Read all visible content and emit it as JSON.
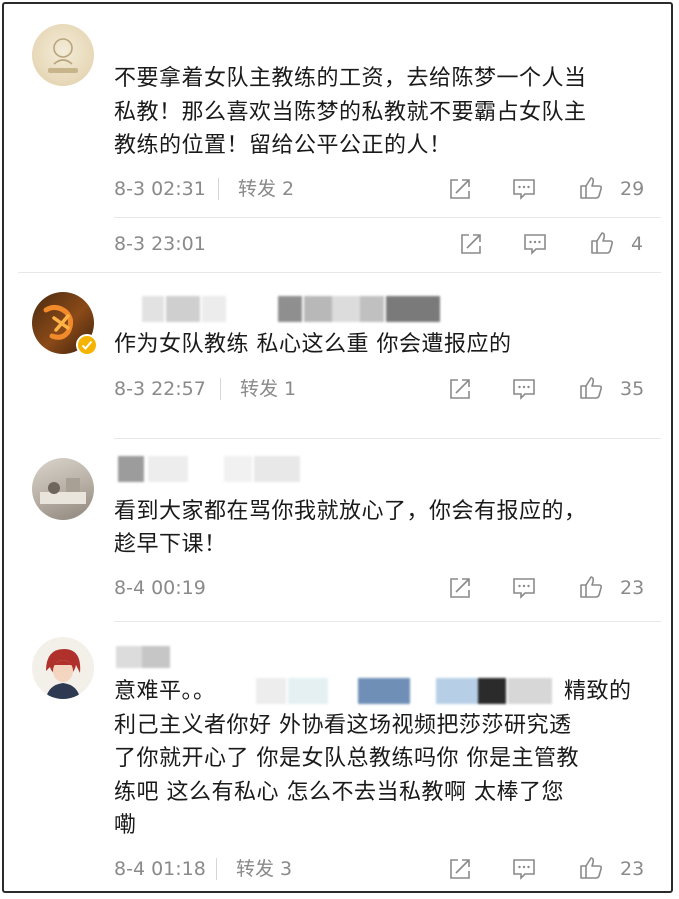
{
  "comments": [
    {
      "text_lines": [
        "不要拿着女队主教练的工资，去给陈梦一个人当",
        "私教！那么喜欢当陈梦的私教就不要霸占女队主",
        "教练的位置！留给公平公正的人！"
      ],
      "time": "8-3 02:31",
      "repost": "转发 2",
      "likes": "29"
    },
    {
      "time": "8-3 23:01",
      "likes": "4"
    },
    {
      "text_lines": [
        "作为女队教练 私心这么重 你会遭报应的"
      ],
      "time": "8-3 22:57",
      "repost": "转发 1",
      "likes": "35"
    },
    {
      "text_lines": [
        "看到大家都在骂你我就放心了，你会有报应的，",
        "趁早下课！"
      ],
      "time": "8-4 00:19",
      "likes": "23"
    },
    {
      "text_lines": [
        "意难平。。",
        "精致的",
        "利己主义者你好  外协看这场视频把莎莎研究透",
        "了你就开心了  你是女队总教练吗你  你是主管教",
        "练吧  这么有私心  怎么不去当私教啊  太棒了您",
        "嘞"
      ],
      "time": "8-4 01:18",
      "repost": "转发 3",
      "likes": "23"
    }
  ],
  "icons": [
    "share-icon",
    "comment-icon",
    "like-icon"
  ],
  "colors": {
    "meta": "#8a8a8a",
    "text": "#1a1a1a",
    "verified": "#f5b400"
  }
}
